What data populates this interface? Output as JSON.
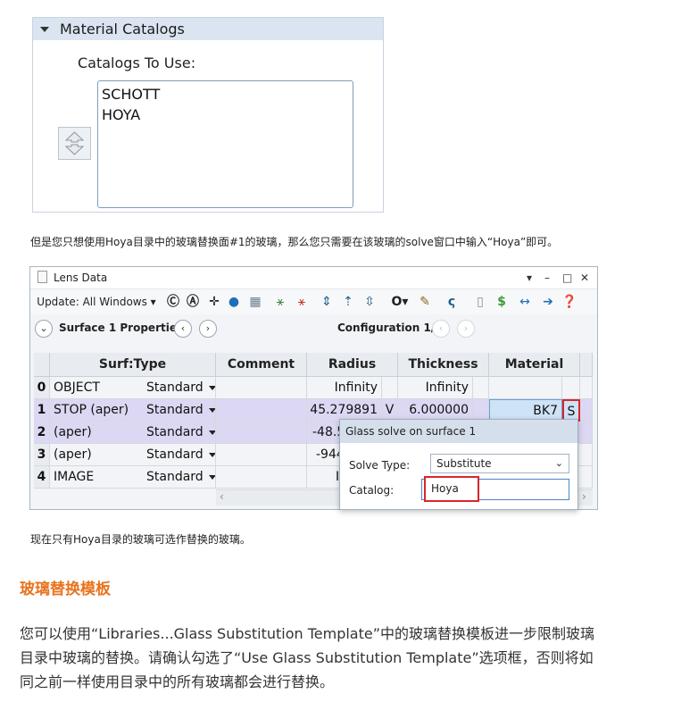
{
  "material_panel": {
    "header": "Material Catalogs",
    "label": "Catalogs To Use:",
    "catalogs": [
      "SCHOTT",
      "HOYA"
    ]
  },
  "text": {
    "para1": "但是您只想使用Hoya目录中的玻璃替换面#1的玻璃，那么您只需要在该玻璃的solve窗口中输入“Hoya”即可。",
    "para2": "现在只有Hoya目录的玻璃可选作替换的玻璃。",
    "heading": "玻璃替换模板",
    "para3_line1": "您可以使用“Libraries...Glass Substitution Template”中的玻璃替换模板进一步限制玻璃",
    "para3_line2": "目录中玻璃的替换。请确认勾选了“Use Glass Substitution Template”选项框，否则将如",
    "para3_line3": "同之前一样使用目录中的所有玻璃都会进行替换。"
  },
  "lens_window": {
    "title": "Lens Data",
    "window_controls": [
      "▾",
      "–",
      "□",
      "✕"
    ],
    "toolbar": {
      "update_label": "Update: All Windows ▾"
    },
    "subbar": {
      "surface_label": "Surface  1 Properties",
      "config_label": "Configuration 1/1"
    },
    "columns": [
      "Surf:Type",
      "Comment",
      "Radius",
      "Thickness",
      "Material"
    ],
    "rows": [
      {
        "num": "0",
        "name": "OBJECT",
        "type": "Standard",
        "comment": "",
        "radius": "Infinity",
        "radius_flag": "",
        "thickness": "Infinity",
        "material": "",
        "mat_flag": ""
      },
      {
        "num": "1",
        "name": "STOP (aper)",
        "type": "Standard",
        "comment": "",
        "radius": "45.279891",
        "radius_flag": "V",
        "thickness": "6.000000",
        "material": "BK7",
        "mat_flag": "S"
      },
      {
        "num": "2",
        "name": "(aper)",
        "type": "Standard",
        "comment": "",
        "radius": "-48.5",
        "radius_flag": "",
        "thickness": "",
        "material": "",
        "mat_flag": ""
      },
      {
        "num": "3",
        "name": "(aper)",
        "type": "Standard",
        "comment": "",
        "radius": "-944",
        "radius_flag": "",
        "thickness": "",
        "material": "",
        "mat_flag": ""
      },
      {
        "num": "4",
        "name": "IMAGE",
        "type": "Standard",
        "comment": "",
        "radius": "I",
        "radius_flag": "",
        "thickness": "",
        "material": "",
        "mat_flag": ""
      }
    ]
  },
  "popup": {
    "title": "Glass solve on surface 1",
    "solve_type_label": "Solve Type:",
    "solve_type_value": "Substitute",
    "catalog_label": "Catalog:",
    "catalog_value": "Hoya"
  }
}
